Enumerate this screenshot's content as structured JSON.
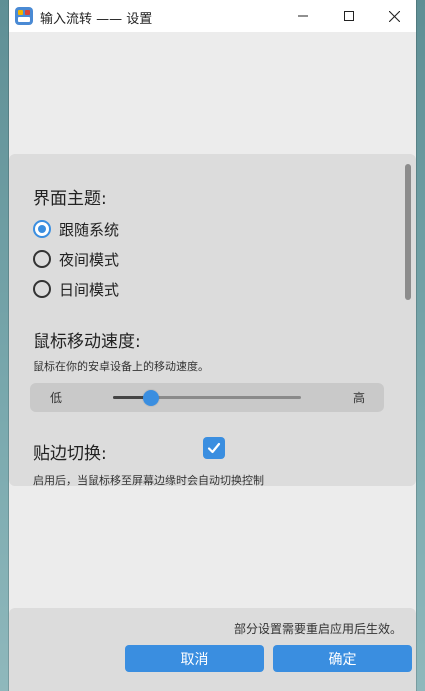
{
  "window": {
    "title": "输入流转 —— 设置",
    "controls": {
      "minimize": "minimize-icon",
      "maximize": "maximize-icon",
      "close": "close-icon"
    }
  },
  "settings": {
    "theme": {
      "title": "界面主题:",
      "options": [
        {
          "label": "跟随系统",
          "selected": true
        },
        {
          "label": "夜间模式",
          "selected": false
        },
        {
          "label": "日间模式",
          "selected": false
        }
      ]
    },
    "mouse_speed": {
      "title": "鼠标移动速度:",
      "description": "鼠标在你的安卓设备上的移动速度。",
      "low_label": "低",
      "high_label": "高",
      "value_fraction": 0.2
    },
    "edge_switch": {
      "title": "贴边切换:",
      "checked": true,
      "description": "启用后，当鼠标移至屏幕边缘时会自动切换控制"
    }
  },
  "footer": {
    "note": "部分设置需要重启应用后生效。",
    "cancel_label": "取消",
    "ok_label": "确定"
  },
  "colors": {
    "accent": "#3a8ee0",
    "panel": "#dcdcdc",
    "window": "#ececec"
  }
}
